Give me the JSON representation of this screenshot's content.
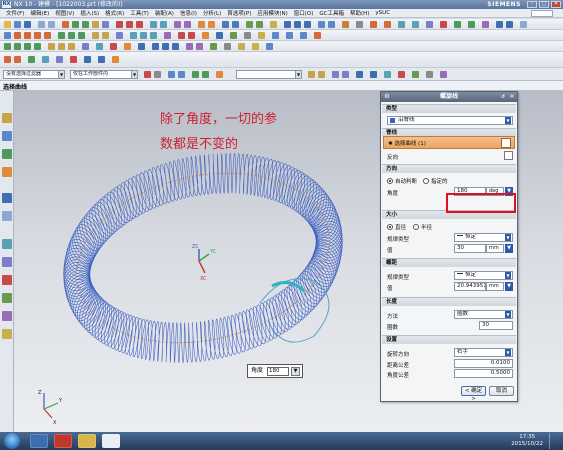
{
  "window": {
    "app_logo": "NX",
    "title": "NX 10 - 建模 - [1022003.prt (修改的)]",
    "brand": "SIEMENS",
    "btn_min": "–",
    "btn_max": "□",
    "btn_close": "✕"
  },
  "menu": [
    "文件(F)",
    "编辑(E)",
    "视图(V)",
    "插入(S)",
    "格式(R)",
    "工具(T)",
    "装配(A)",
    "信息(I)",
    "分析(L)",
    "首选项(P)",
    "应用模块(N)",
    "窗口(O)",
    "GC工具箱",
    "帮助(H)",
    "ySUC"
  ],
  "selection_bar": {
    "filter": "没有选择过滤器",
    "scope": "仅在工作部件内"
  },
  "command_prompt": "选择曲线",
  "viewport": {
    "note_line1": "除了角度，一切的参",
    "note_line2": "数都是不变的",
    "angle_tip_label": "角度",
    "angle_tip_value": "180"
  },
  "dialog": {
    "title": "螺旋线",
    "btn_settings": "⚙",
    "btn_close": "✕",
    "sec_type": "类型",
    "type_value": "沿脊线",
    "sec_spine": "脊线",
    "select_curve": "✱ 选择曲线 (1)",
    "reverse": "反向",
    "sec_direction": "方向",
    "radio_auto": "自动判断",
    "radio_specified": "指定的",
    "angle_label": "角度",
    "angle_value": "180",
    "angle_unit": "deg",
    "sec_size": "大小",
    "radio_diameter": "直径",
    "radio_radius": "半径",
    "size_law_label": "规律类型",
    "size_law_value": "恒定",
    "size_value_label": "值",
    "size_value": "30",
    "size_unit": "mm",
    "sec_pitch": "螺距",
    "pitch_law_label": "规律类型",
    "pitch_law_value": "恒定",
    "pitch_value_label": "值",
    "pitch_value": "20.943951",
    "pitch_unit": "mm",
    "sec_length": "长度",
    "method_label": "方法",
    "method_value": "圈数",
    "turns_label": "圈数",
    "turns_value": "30",
    "sec_settings": "设置",
    "rotation_label": "旋转方向",
    "rotation_value": "右手",
    "dist_tol_label": "距离公差",
    "dist_tol_value": "0.0100",
    "angle_tol_label": "角度公差",
    "angle_tol_value": "0.5000",
    "ok": "< 确定 >",
    "cancel": "取消"
  },
  "triad": {
    "zc": "ZC",
    "yc": "YC",
    "xc": "XC"
  },
  "corner_axes": {
    "x": "X",
    "y": "Y",
    "z": "Z"
  },
  "taskbar": {
    "time": "17:35",
    "date": "2015/10/22"
  },
  "colors": {
    "helix": "#3c5fbf",
    "spine": "#e39a52",
    "note": "#d01f2f",
    "highlight": "#e01020"
  }
}
